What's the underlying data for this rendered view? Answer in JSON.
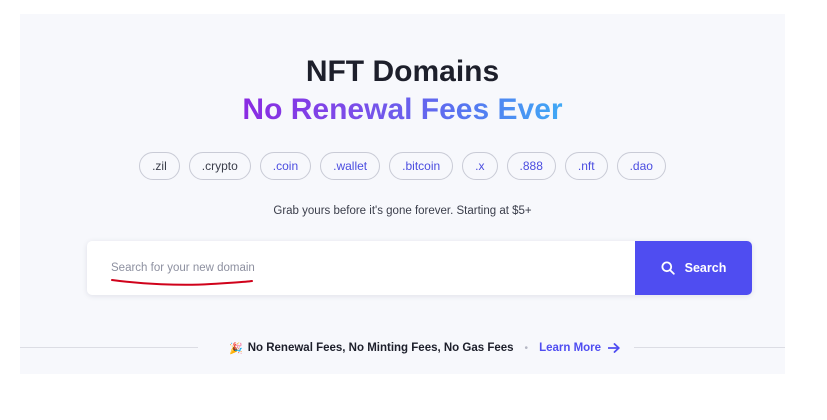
{
  "hero": {
    "title_line1": "NFT Domains",
    "title_line2": "No Renewal Fees Ever",
    "gradient_colors": [
      "#8a2be2",
      "#5b6ff0",
      "#3fa9f5"
    ]
  },
  "extensions": [
    {
      "label": ".zil",
      "color": "#3a3d4a"
    },
    {
      "label": ".crypto",
      "color": "#3a3d4a"
    },
    {
      "label": ".coin",
      "color": "#4b4de0"
    },
    {
      "label": ".wallet",
      "color": "#4b4de0"
    },
    {
      "label": ".bitcoin",
      "color": "#4b4de0"
    },
    {
      "label": ".x",
      "color": "#4b4de0"
    },
    {
      "label": ".888",
      "color": "#4b4de0"
    },
    {
      "label": ".nft",
      "color": "#4b4de0"
    },
    {
      "label": ".dao",
      "color": "#4b4de0"
    }
  ],
  "subtitle": "Grab yours before it's gone forever. Starting at $5+",
  "search": {
    "placeholder": "Search for your new domain",
    "value": "",
    "button_label": "Search",
    "button_icon": "search-icon",
    "button_color": "#4f4df1",
    "annotation_color": "#d0021b"
  },
  "footer": {
    "icon": "party-popper-icon",
    "features_text": "No Renewal Fees, No Minting Fees, No Gas Fees",
    "separator": "•",
    "link_label": "Learn More",
    "link_icon": "arrow-right-icon"
  }
}
